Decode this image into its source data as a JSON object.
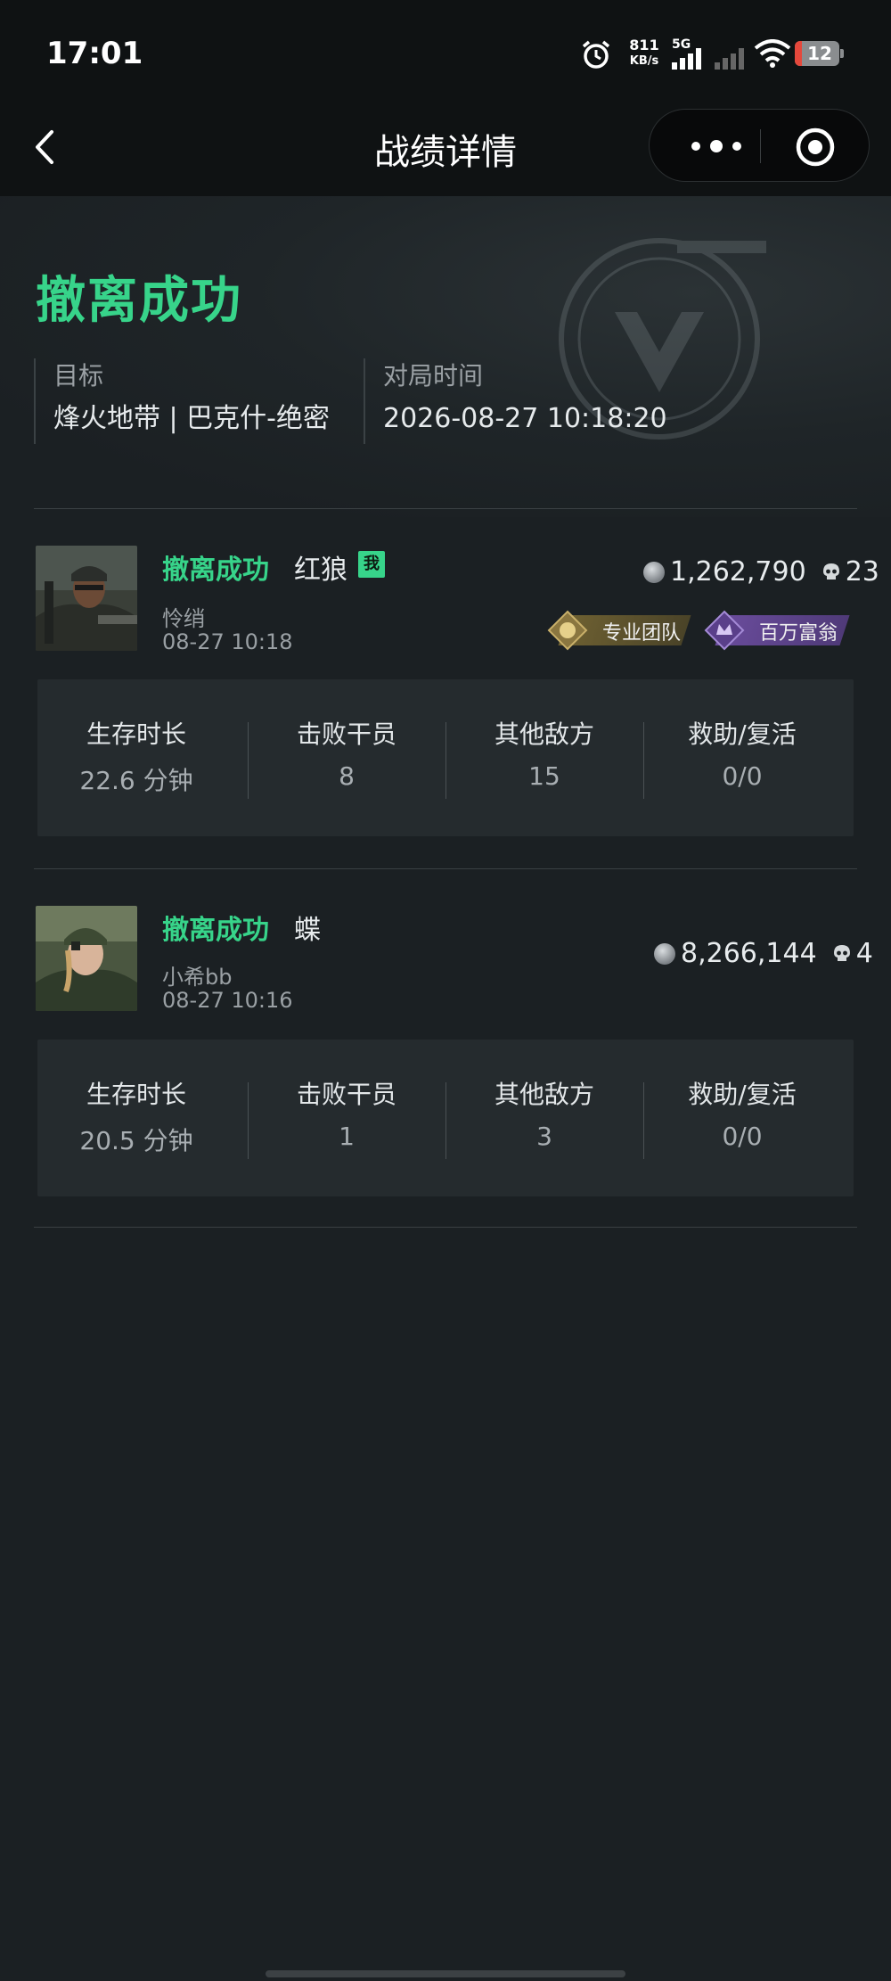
{
  "status_bar": {
    "time": "17:01",
    "net_speed_value": "811",
    "net_speed_unit": "KB/s",
    "network_type": "5G",
    "battery": "12",
    "icons": [
      "alarm-icon",
      "signal-icon",
      "wifi-icon",
      "battery-icon"
    ]
  },
  "nav": {
    "title": "战绩详情",
    "back_icon": "chevron-left-icon",
    "more_icon": "more-dots-icon",
    "close_icon": "target-circle-icon"
  },
  "summary": {
    "result": "撤离成功",
    "target_label": "目标",
    "target_value": "烽火地带 | 巴克什-绝密",
    "time_label": "对局时间",
    "time_value": "2026-08-27 10:18:20"
  },
  "players": [
    {
      "status": "撤离成功",
      "name": "红狼",
      "me_badge": "我",
      "nickname": "怜绡",
      "time": "08-27 10:18",
      "money": "1,262,790",
      "kills_icon_count": "23",
      "tags": [
        {
          "label": "专业团队",
          "color": "#7a6a3a",
          "icon": "team-badge-icon"
        },
        {
          "label": "百万富翁",
          "color": "#6b4c9a",
          "icon": "millionaire-badge-icon"
        }
      ],
      "stats": [
        {
          "label": "生存时长",
          "value": "22.6 分钟"
        },
        {
          "label": "击败干员",
          "value": "8"
        },
        {
          "label": "其他敌方",
          "value": "15"
        },
        {
          "label": "救助/复活",
          "value": "0/0"
        }
      ]
    },
    {
      "status": "撤离成功",
      "name": "蝶",
      "nickname": "小希bb",
      "time": "08-27 10:16",
      "money": "8,266,144",
      "kills_icon_count": "4",
      "stats": [
        {
          "label": "生存时长",
          "value": "20.5 分钟"
        },
        {
          "label": "击败干员",
          "value": "1"
        },
        {
          "label": "其他敌方",
          "value": "3"
        },
        {
          "label": "救助/复活",
          "value": "0/0"
        }
      ]
    }
  ],
  "colors": {
    "accent": "#37d48a",
    "background": "#1b2023",
    "card": "#252b2e"
  }
}
